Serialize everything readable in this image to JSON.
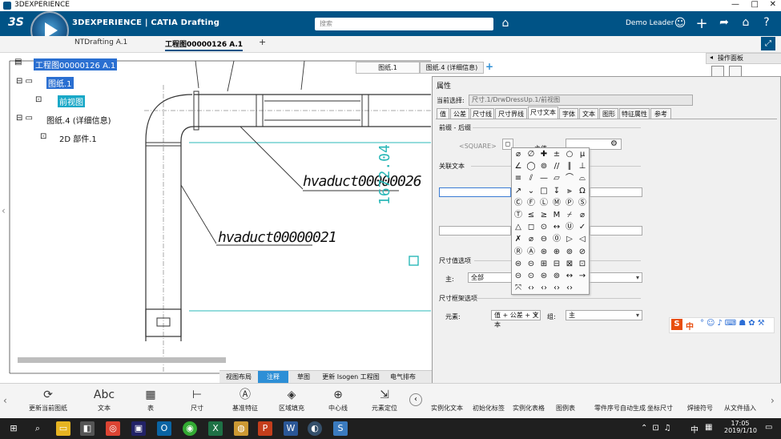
{
  "window": {
    "title": "3DEXPERIENCE"
  },
  "app": {
    "brand": "3DEXPERIENCE | CATIA Drafting",
    "search_placeholder": "搜索",
    "user": "Demo Leader"
  },
  "tabs": {
    "doc1": "NTDrafting A.1",
    "doc2": "工程图00000126 A.1",
    "add": "+"
  },
  "tree": {
    "root": "工程图00000126 A.1",
    "sheet1": "图纸.1",
    "front_view": "前视图",
    "sheet4": "图纸.4 (详细信息)",
    "part2d": "2D 部件.1"
  },
  "sheet_tabs": {
    "tab1": "图纸.1",
    "tab2": "图纸.4 (详细信息)",
    "add": "+"
  },
  "ops_panel": {
    "title": "操作面板"
  },
  "drawing": {
    "label1": "hvaduct00000026",
    "label2": "hvaduct00000021",
    "dimension": "1672.04"
  },
  "properties": {
    "title": "属性",
    "current_label": "当前选择:",
    "current_value": "尺寸.1/DrwDressUp.1/前视图",
    "tabs": [
      "值",
      "公差",
      "尺寸线",
      "尺寸界线",
      "尺寸文本",
      "字体",
      "文本",
      "图形",
      "特征属性",
      "参考"
    ],
    "prefix_suffix": "前缀 - 后缀",
    "square_placeholder": "<SQUARE>",
    "main_value": "主值",
    "associated_text": "关联文本",
    "value_options": "尺寸值选项",
    "main_label": "主:",
    "main_value_select": "全部",
    "frame_options": "尺寸框架选项",
    "element_label": "元素:",
    "element_value": "值 + 公差 + 文本",
    "group_label": "组:",
    "group_value": "主"
  },
  "palette_symbols": [
    "⌀",
    "∅",
    "✚",
    "±",
    "○",
    "μ",
    "∠",
    "◯",
    "⊚",
    "//",
    "∥",
    "⊥",
    "≡",
    "⫽",
    "—",
    "▱",
    "⌒",
    "⌓",
    "↗",
    "⌄",
    "□",
    "↧",
    "⫸",
    "Ω",
    "Ⓒ",
    "Ⓕ",
    "Ⓛ",
    "Ⓜ",
    "Ⓟ",
    "Ⓢ",
    "Ⓣ",
    "≤",
    "≥",
    "M",
    "⌿",
    "⌀",
    "△",
    "◻",
    "⊙",
    "↔",
    "Ⓤ",
    "✓",
    "✗",
    "⌀",
    "⊖",
    "⓪",
    "▷",
    "◁",
    "Ⓡ",
    "Ⓐ",
    "⊛",
    "⊕",
    "⊚",
    "⊘",
    "⊜",
    "⊝",
    "⊞",
    "⊟",
    "⊠",
    "⊡",
    "⊝",
    "⊙",
    "⊜",
    "⊚",
    "↔",
    "→",
    "⤧",
    "‹›",
    "‹›",
    "‹›",
    "‹›",
    ""
  ],
  "section_tabs": [
    "视图布局",
    "注释",
    "草图",
    "更新 Isogen 工程图",
    "电气排布"
  ],
  "toolbar": {
    "update_sheet": "更新当前图纸",
    "text": "文本",
    "table": "表",
    "dimension": "尺寸",
    "datum_feature": "基准特征",
    "area_fill": "区域填充",
    "center_line": "中心线",
    "element_position": "元素定位",
    "right_labels": [
      "实例化文本",
      "初始化标签",
      "实例化表格",
      "图例表",
      "零件序号自动生成",
      "坐标尺寸",
      "焊接符号",
      "从文件插入"
    ],
    "text_icon": "Abc"
  },
  "ime": {
    "label": "中"
  },
  "taskbar": {
    "ime_indicator": "中",
    "time": "17:05",
    "date": "2019/1/10"
  }
}
